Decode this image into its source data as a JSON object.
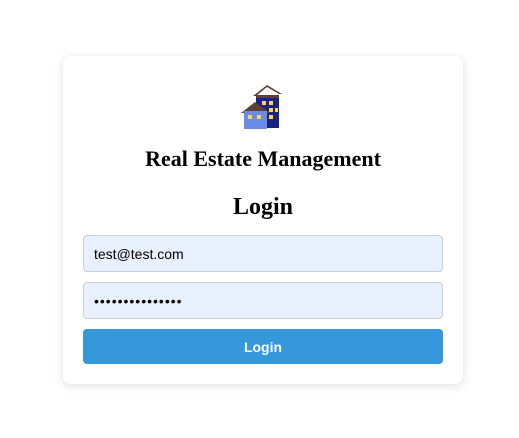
{
  "card": {
    "logo_icon": "buildings-icon",
    "app_title": "Real Estate Management",
    "login_heading": "Login"
  },
  "form": {
    "email_value": "test@test.com",
    "password_value": "•••••••••••••••",
    "submit_label": "Login"
  },
  "colors": {
    "button_bg": "#3498db",
    "input_bg": "#e8f0fe",
    "card_bg": "#ffffff"
  }
}
